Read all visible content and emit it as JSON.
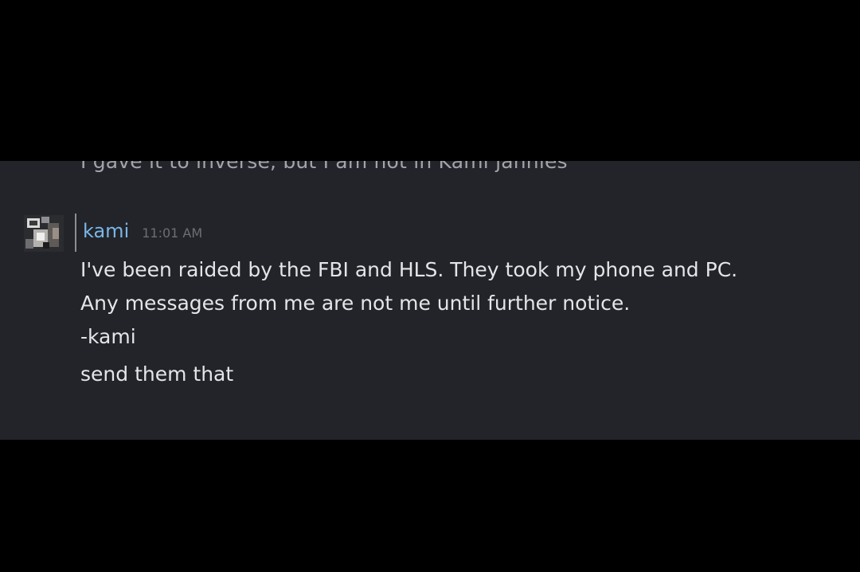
{
  "chat": {
    "previous_message": "I gave it to inverse, but I am not in Kami jannies",
    "message": {
      "author": "kami",
      "timestamp": "11:01 AM",
      "author_color": "#7ab6e6",
      "avatar_icon": "user-avatar",
      "lines": [
        "I've been raided by the FBI and HLS. They took my phone and PC.",
        "Any messages from me are not me until further notice.",
        "-kami",
        "send them that"
      ]
    }
  }
}
